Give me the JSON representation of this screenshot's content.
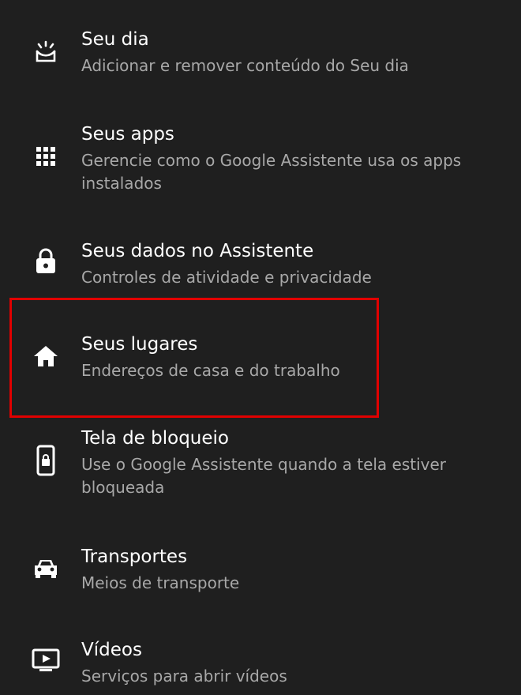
{
  "items": [
    {
      "title": "Seu dia",
      "subtitle": "Adicionar e remover conteúdo do Seu dia",
      "icon": "sunrise-icon"
    },
    {
      "title": "Seus apps",
      "subtitle": "Gerencie como o Google Assistente usa os apps instalados",
      "icon": "apps-grid-icon"
    },
    {
      "title": "Seus dados no Assistente",
      "subtitle": "Controles de atividade e privacidade",
      "icon": "lock-icon"
    },
    {
      "title": "Seus lugares",
      "subtitle": "Endereços de casa e do trabalho",
      "icon": "home-icon"
    },
    {
      "title": "Tela de bloqueio",
      "subtitle": "Use o Google Assistente quando a tela estiver bloqueada",
      "icon": "phone-lock-icon"
    },
    {
      "title": "Transportes",
      "subtitle": "Meios de transporte",
      "icon": "car-icon"
    },
    {
      "title": "Vídeos",
      "subtitle": "Serviços para abrir vídeos",
      "icon": "tv-play-icon"
    }
  ],
  "highlight_color": "#e10000",
  "colors": {
    "background": "#1f1f1f",
    "title": "#ffffff",
    "subtitle": "#a8a8a8"
  }
}
